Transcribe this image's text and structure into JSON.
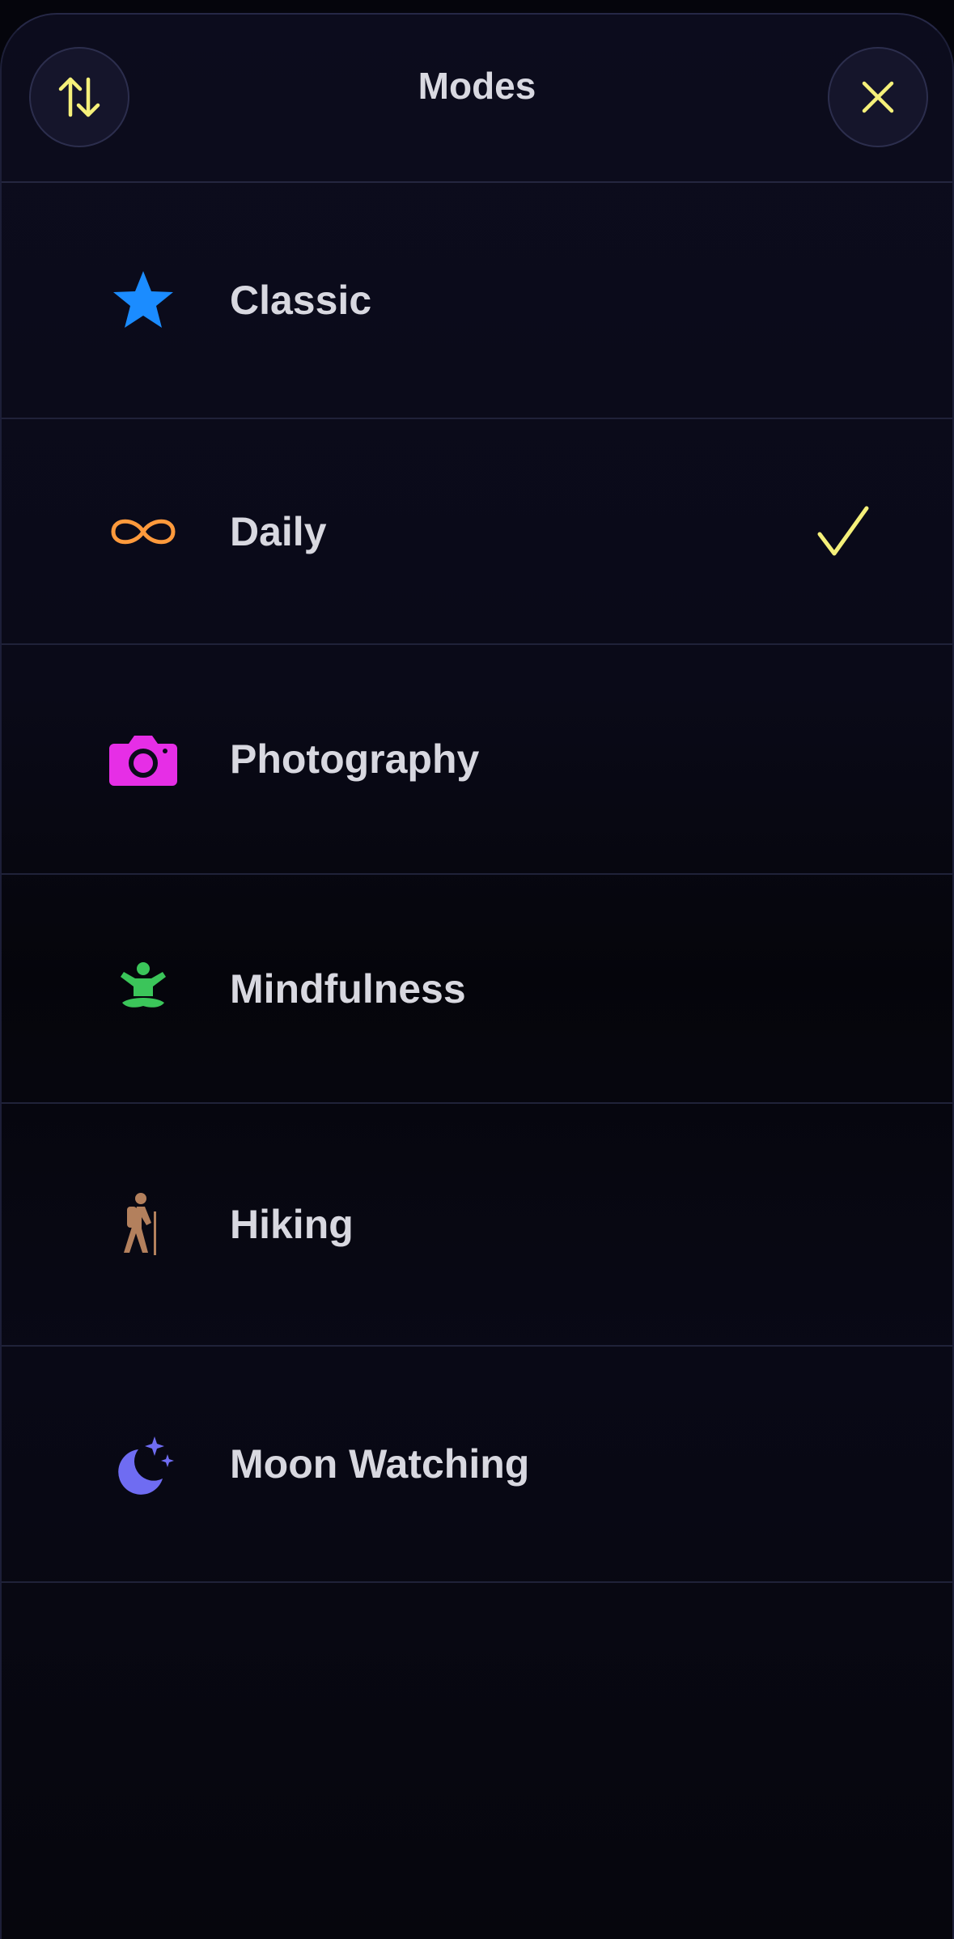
{
  "header": {
    "title": "Modes",
    "sort_icon": "sort-arrows-icon",
    "close_icon": "close-icon"
  },
  "colors": {
    "accent": "#f5f07a",
    "classic": "#1b8cff",
    "daily": "#ff9a3c",
    "photography": "#e62ee6",
    "mindfulness": "#3bc55a",
    "hiking": "#b3805d",
    "moon": "#6f6cf2"
  },
  "modes": [
    {
      "label": "Classic",
      "icon": "star-icon",
      "selected": false
    },
    {
      "label": "Daily",
      "icon": "infinity-icon",
      "selected": true
    },
    {
      "label": "Photography",
      "icon": "camera-icon",
      "selected": false
    },
    {
      "label": "Mindfulness",
      "icon": "meditation-icon",
      "selected": false
    },
    {
      "label": "Hiking",
      "icon": "hiker-icon",
      "selected": false
    },
    {
      "label": "Moon Watching",
      "icon": "moon-stars-icon",
      "selected": false
    }
  ]
}
